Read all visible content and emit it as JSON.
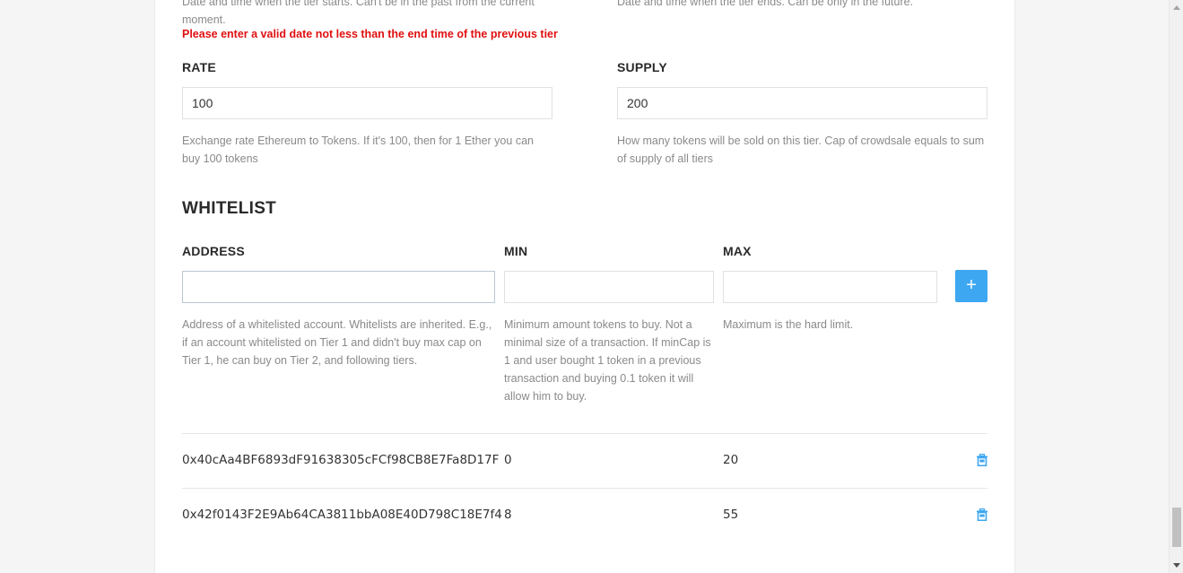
{
  "start_time": {
    "hint": "Date and time when the tier starts. Can't be in the past from the current moment.",
    "error": "Please enter a valid date not less than the end time of the previous tier"
  },
  "end_time": {
    "hint": "Date and time when the tier ends. Can be only in the future."
  },
  "rate": {
    "label": "RATE",
    "value": "100",
    "hint": "Exchange rate Ethereum to Tokens. If it's 100, then for 1 Ether you can buy 100 tokens"
  },
  "supply": {
    "label": "SUPPLY",
    "value": "200",
    "hint": "How many tokens will be sold on this tier. Cap of crowdsale equals to sum of supply of all tiers"
  },
  "whitelist": {
    "title": "WHITELIST",
    "address_label": "ADDRESS",
    "min_label": "MIN",
    "max_label": "MAX",
    "address_value": "",
    "min_value": "",
    "max_value": "",
    "add_button_label": "+",
    "address_hint": "Address of a whitelisted account. Whitelists are inherited. E.g., if an account whitelisted on Tier 1 and didn't buy max cap on Tier 1, he can buy on Tier 2, and following tiers.",
    "min_hint": "Minimum amount tokens to buy. Not a minimal size of a transaction. If minCap is 1 and user bought 1 token in a previous transaction and buying 0.1 token it will allow him to buy.",
    "max_hint": "Maximum is the hard limit.",
    "rows": [
      {
        "address": "0x40cAa4BF6893dF91638305cFCf98CB8E7Fa8D17F",
        "min": "0",
        "max": "20"
      },
      {
        "address": "0x42f0143F2E9Ab64CA3811bbA08E40D798C18E7f4",
        "min": "8",
        "max": "55"
      }
    ]
  },
  "icons": {
    "delete": "trash-icon",
    "add": "plus-icon"
  },
  "colors": {
    "accent": "#3ea7f1",
    "error": "#e01010"
  }
}
